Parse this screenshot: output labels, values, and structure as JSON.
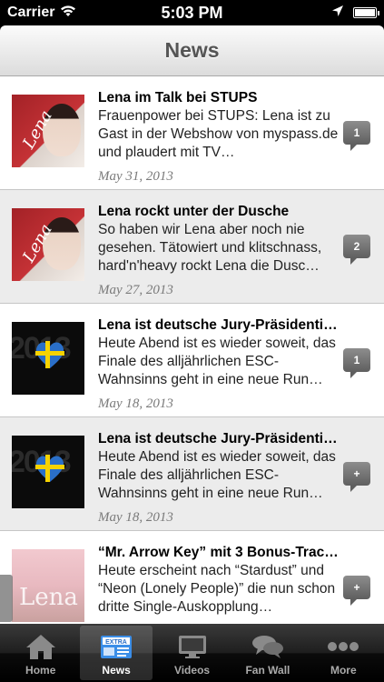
{
  "status_bar": {
    "carrier": "Carrier",
    "time": "5:03 PM"
  },
  "nav": {
    "title": "News"
  },
  "news": [
    {
      "title": "Lena im Talk bei STUPS",
      "body": "Frauenpower bei STUPS: Lena ist zu Gast in der Webshow von myspass.de und plaudert mit TV…",
      "date": "May 31, 2013",
      "comments": "1",
      "thumbnail": "lena-portrait-red",
      "thumb_text": "Lena"
    },
    {
      "title": "Lena rockt unter der Dusche",
      "body": "So haben wir Lena aber noch nie gesehen. Tätowiert und klitschnass, hard'n'heavy rockt Lena die Dusc…",
      "date": "May 27, 2013",
      "comments": "2",
      "thumbnail": "lena-portrait-red",
      "thumb_text": "Lena"
    },
    {
      "title": "Lena ist deutsche Jury-Präsidenti…",
      "body": "Heute Abend ist es wieder soweit, das Finale des alljährlichen ESC-Wahnsinns geht in eine neue Run…",
      "date": "May 18, 2013",
      "comments": "1",
      "thumbnail": "esc-heart-logo",
      "thumb_text": "2013"
    },
    {
      "title": "Lena ist deutsche Jury-Präsidenti…",
      "body": "Heute Abend ist es wieder soweit, das Finale des alljährlichen ESC-Wahnsinns geht in eine neue Run…",
      "date": "May 18, 2013",
      "comments": "+",
      "thumbnail": "esc-heart-logo",
      "thumb_text": "2013"
    },
    {
      "title": "“Mr. Arrow Key” mit 3 Bonus-Trac…",
      "body": "Heute erscheint nach “Stardust” und “Neon (Lonely People)” die nun schon dritte Single-Auskopplung…",
      "date": "",
      "comments": "+",
      "thumbnail": "lena-album-pink",
      "thumb_text": "Lena"
    }
  ],
  "tabs": [
    {
      "label": "Home",
      "icon": "house-icon",
      "active": false
    },
    {
      "label": "News",
      "icon": "newspaper-icon",
      "active": true,
      "icon_text": "EXTRA"
    },
    {
      "label": "Videos",
      "icon": "tv-icon",
      "active": false
    },
    {
      "label": "Fan Wall",
      "icon": "chat-bubbles-icon",
      "active": false
    },
    {
      "label": "More",
      "icon": "more-dots-icon",
      "active": false
    }
  ],
  "colors": {
    "nav_title": "#555555",
    "badge": "#6f6f6f",
    "date": "#7a7a7a",
    "alt_row": "#ececec"
  }
}
